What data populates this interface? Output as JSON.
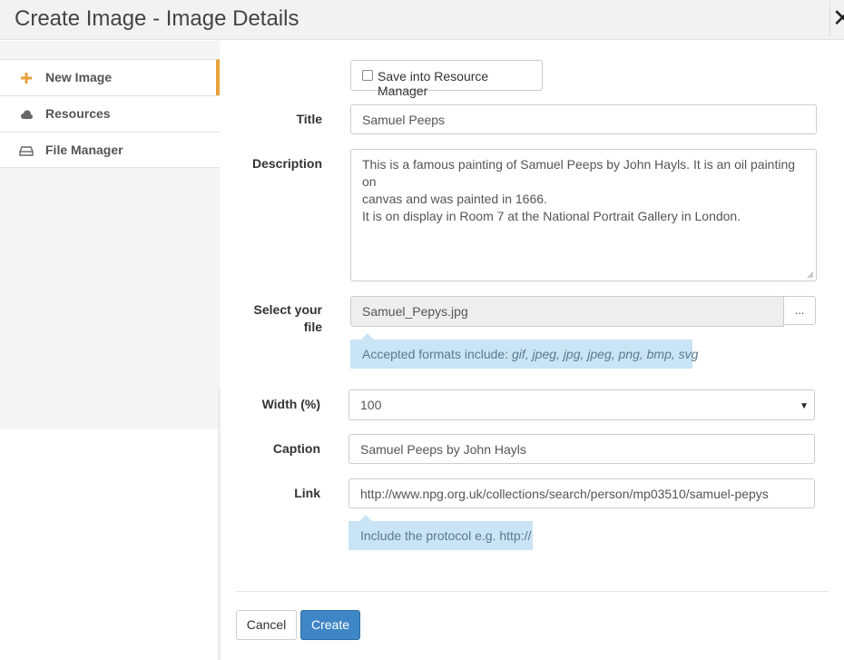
{
  "window": {
    "title": "Create Image - Image Details",
    "close_icon": "close-icon"
  },
  "sidebar": {
    "items": [
      {
        "label": "New Image",
        "icon": "plus-icon",
        "active": true
      },
      {
        "label": "Resources",
        "icon": "cloud-icon",
        "active": false
      },
      {
        "label": "File Manager",
        "icon": "drive-icon",
        "active": false
      }
    ]
  },
  "form": {
    "save_resource_label": "Save into Resource Manager",
    "save_resource_checked": false,
    "title_label": "Title",
    "title_value": "Samuel Peeps",
    "description_label": "Description",
    "description_lines": [
      "This is a famous painting of Samuel Peeps by John Hayls. It is an oil painting on",
      "canvas and was painted in 1666.",
      "It is on display in Room 7 at the National Portrait Gallery in London."
    ],
    "file_label_line1": "Select your",
    "file_label_line2": "file",
    "file_value": "Samuel_Pepys.jpg",
    "browse_label": "...",
    "formats_hint_prefix": "Accepted formats include: ",
    "formats_hint_list": "gif, jpeg, jpg, jpeg, png, bmp, svg",
    "width_label": "Width (%)",
    "width_value": "100",
    "caption_label": "Caption",
    "caption_value": "Samuel Peeps by John Hayls",
    "link_label": "Link",
    "link_value": "http://www.npg.org.uk/collections/search/person/mp03510/samuel-pepys",
    "link_hint": "Include the protocol e.g. http://"
  },
  "footer": {
    "cancel_label": "Cancel",
    "create_label": "Create"
  },
  "colors": {
    "accent": "#e8a13a",
    "primary": "#3f86c6",
    "hint_bg": "#c9e4f4"
  }
}
